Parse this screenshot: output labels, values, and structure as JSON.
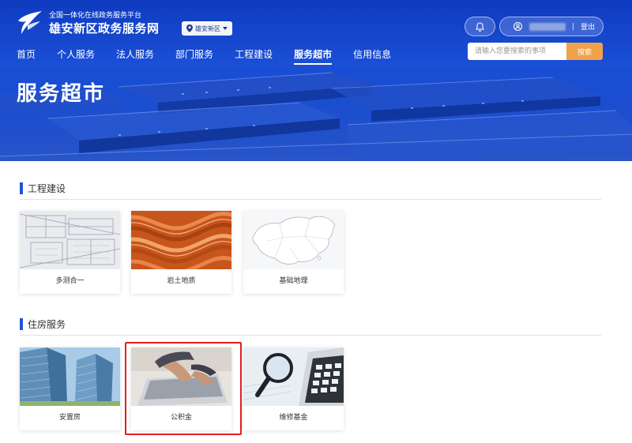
{
  "header": {
    "subtitle": "全国一体化在线政务服务平台",
    "title": "雄安新区政务服务网",
    "region": "雄安新区",
    "logout": "登出"
  },
  "nav": [
    {
      "label": "首页",
      "active": false
    },
    {
      "label": "个人服务",
      "active": false
    },
    {
      "label": "法人服务",
      "active": false
    },
    {
      "label": "部门服务",
      "active": false
    },
    {
      "label": "工程建设",
      "active": false
    },
    {
      "label": "服务超市",
      "active": true
    },
    {
      "label": "信用信息",
      "active": false
    }
  ],
  "search": {
    "placeholder": "请输入您要搜索的事项",
    "button": "搜索"
  },
  "page_title": "服务超市",
  "sections": [
    {
      "title": "工程建设",
      "cards": [
        {
          "label": "多测合一",
          "image": "blueprint-image"
        },
        {
          "label": "岩土地质",
          "image": "rock-strata-image"
        },
        {
          "label": "基础地理",
          "image": "china-map-image"
        }
      ]
    },
    {
      "title": "住房服务",
      "cards": [
        {
          "label": "安置房",
          "image": "buildings-image"
        },
        {
          "label": "公积金",
          "image": "laptop-hands-image",
          "highlighted": true
        },
        {
          "label": "维修基金",
          "image": "magnifier-calculator-image"
        }
      ]
    }
  ],
  "colors": {
    "brand_blue": "#1f54d9",
    "search_button": "#f0a24a",
    "highlight": "#e02020"
  }
}
